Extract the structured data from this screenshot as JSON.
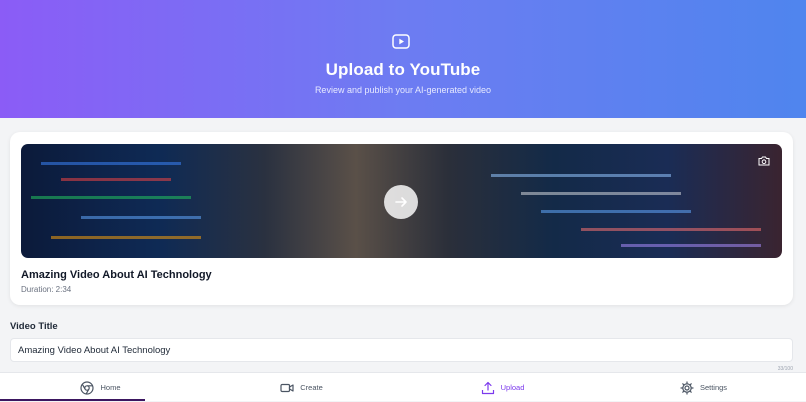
{
  "header": {
    "icon": "youtube-play-icon",
    "title": "Upload to YouTube",
    "subtitle": "Review and publish your AI-generated video",
    "gradient": [
      "#8b5cf6",
      "#4f85ee"
    ]
  },
  "video_card": {
    "thumbnail_icon": "camera-icon",
    "play_icon": "play-arrow-icon",
    "title": "Amazing Video About AI Technology",
    "duration": "Duration: 2:34"
  },
  "form": {
    "title_label": "Video Title",
    "title_value": "Amazing Video About AI Technology",
    "char_count": "33/100"
  },
  "bottom_nav": {
    "items": [
      {
        "label": "Home",
        "icon": "chrome-icon"
      },
      {
        "label": "Create",
        "icon": "video-camera-icon"
      },
      {
        "label": "Upload",
        "icon": "upload-icon",
        "active": true
      },
      {
        "label": "Settings",
        "icon": "gear-icon"
      }
    ],
    "accent": "#7c3aed"
  }
}
